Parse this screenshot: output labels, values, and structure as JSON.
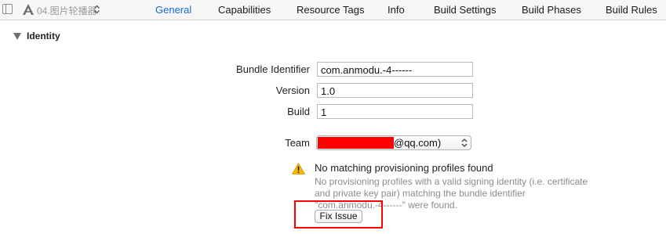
{
  "toolbar": {
    "target_name": "04.图片轮播器",
    "tabs": [
      {
        "label": "General",
        "active": true
      },
      {
        "label": "Capabilities",
        "active": false
      },
      {
        "label": "Resource Tags",
        "active": false
      },
      {
        "label": "Info",
        "active": false
      },
      {
        "label": "Build Settings",
        "active": false
      },
      {
        "label": "Build Phases",
        "active": false
      },
      {
        "label": "Build Rules",
        "active": false
      }
    ]
  },
  "section": {
    "title": "Identity",
    "expanded": true
  },
  "form": {
    "bundle_identifier": {
      "label": "Bundle Identifier",
      "value": "com.anmodu.-4------"
    },
    "version": {
      "label": "Version",
      "value": "1.0"
    },
    "build": {
      "label": "Build",
      "value": "1"
    },
    "team": {
      "label": "Team",
      "value_suffix": "@qq.com)",
      "redacted": true
    }
  },
  "warning": {
    "title": "No matching provisioning profiles found",
    "message": "No provisioning profiles with a valid signing identity (i.e. certificate and private key pair) matching the bundle identifier \"com.anmodu.-4------\" were found.",
    "button_label": "Fix Issue"
  },
  "colors": {
    "active_tab": "#1b6ad6",
    "redaction": "#ff0000",
    "highlight": "#ff0000",
    "warning": "#f5b800"
  },
  "icons": [
    "sidebar-toggle-icon",
    "app-target-icon",
    "chevron-updown-icon",
    "disclosure-triangle-icon",
    "warning-icon",
    "popup-arrows-icon"
  ]
}
